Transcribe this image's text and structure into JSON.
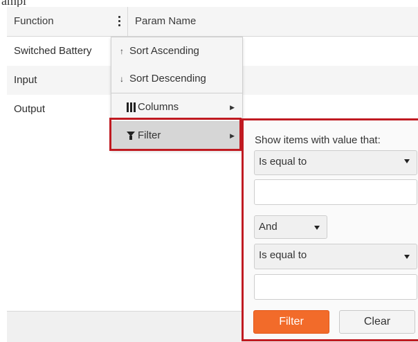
{
  "page": {
    "top_text": "ampl"
  },
  "grid": {
    "columns": {
      "function": "Function",
      "param_name": "Param Name"
    },
    "rows": [
      {
        "function": "Switched Battery"
      },
      {
        "function": "Input"
      },
      {
        "function": "Output"
      }
    ]
  },
  "column_menu": {
    "sort_asc": {
      "icon": "↑",
      "label": "Sort Ascending"
    },
    "sort_desc": {
      "icon": "↓",
      "label": "Sort Descending"
    },
    "columns": {
      "label": "Columns"
    },
    "filter": {
      "label": "Filter"
    }
  },
  "filter_panel": {
    "title": "Show items with value that:",
    "operator1": "Is equal to",
    "value1": "",
    "logic": "And",
    "operator2": "Is equal to",
    "value2": "",
    "filter_button": "Filter",
    "clear_button": "Clear"
  },
  "colors": {
    "highlight": "#c01a21",
    "filter_button": "#f26b2a"
  }
}
